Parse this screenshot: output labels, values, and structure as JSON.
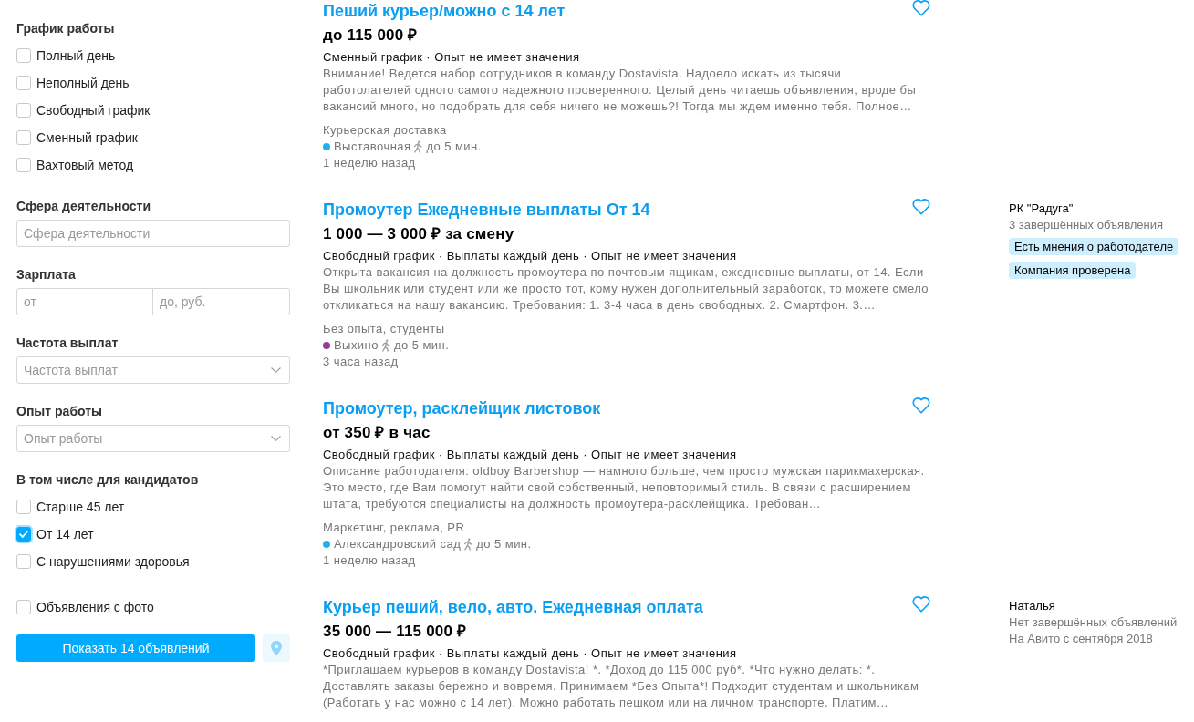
{
  "filters": {
    "sections": [
      {
        "kind": "checkboxes",
        "heading": "График работы",
        "options": [
          {
            "label": "Полный день",
            "checked": false
          },
          {
            "label": "Неполный день",
            "checked": false
          },
          {
            "label": "Свободный график",
            "checked": false
          },
          {
            "label": "Сменный график",
            "checked": false
          },
          {
            "label": "Вахтовый метод",
            "checked": false
          }
        ]
      },
      {
        "kind": "text",
        "heading": "Сфера деятельности",
        "placeholder": "Сфера деятельности"
      },
      {
        "kind": "range",
        "heading": "Зарплата",
        "fields": [
          {
            "placeholder": "от"
          },
          {
            "placeholder": "до, руб."
          }
        ]
      },
      {
        "kind": "select",
        "heading": "Частота выплат",
        "placeholder": "Частота выплат"
      },
      {
        "kind": "select",
        "heading": "Опыт работы",
        "placeholder": "Опыт работы"
      },
      {
        "kind": "checkboxes",
        "heading": "В том числе для кандидатов",
        "options": [
          {
            "label": "Старше 45 лет",
            "checked": false
          },
          {
            "label": "От 14 лет",
            "checked": true
          },
          {
            "label": "С нарушениями здоровья",
            "checked": false
          }
        ]
      },
      {
        "kind": "checkboxes",
        "options": [
          {
            "label": "Объявления с фото",
            "checked": false
          }
        ]
      }
    ],
    "show_button": "Показать 14 объявлений"
  },
  "listings": [
    {
      "title": "Пеший курьер/можно с 14 лет",
      "favorite": false,
      "price": "до 115 000 ₽",
      "tags": "Сменный график · Опыт не имеет значения",
      "description": "Внимание! Ведется набор сотрудников в команду Dostavista. Надоело искать из тысячи работолателей одного самого надежного проверенного. Целый день читаешь объявления, вроде бы вакансий много, но подобрать для себя ничего не можешь?! Тогда мы ждем именно тебя. Полное…",
      "category": "Курьерская доставка",
      "metro": {
        "station": "Выставочная",
        "color": "#1fb2e8",
        "walk": "до 5 мин."
      },
      "posted": "1 неделю назад"
    },
    {
      "title": "Промоутер Ежедневные выплаты От 14",
      "favorite": false,
      "price": "1 000 — 3 000 ₽ за смену",
      "tags": "Свободный график · Выплаты каждый день · Опыт не имеет значения",
      "description": "Открыта вакансия на должность промоутера по почтовым ящикам, ежедневные выплаты, от 14. Если Вы школьник или студент или же просто тот, кому нужен дополнительный заработок, то можете смело откликаться на нашу вакансию. Требования: 1. 3-4 часа в день свободных. 2. Смартфон. 3.…",
      "category": "Без опыта, студенты",
      "metro": {
        "station": "Выхино",
        "color": "#943e93",
        "walk": "до 5 мин."
      },
      "posted": "3 часа назад",
      "seller": {
        "name": "РК \"Радуга\"",
        "info": [
          "3 завершённых объявления"
        ],
        "badges": [
          "Есть мнения о работодателе",
          "Компания проверена"
        ]
      }
    },
    {
      "title": "Промоутер, расклейщик листовок",
      "favorite": false,
      "price": "от 350 ₽ в час",
      "tags": "Свободный график · Выплаты каждый день · Опыт не имеет значения",
      "description": "Описание работодателя: oldboy Barbershop — намного больше, чем просто мужская парикмахерская. Это место, где Вам помогут найти свой собственный, неповторимый стиль. В связи с расширением штата, требуются специалисты на должность промоутера-расклейщика. Требован…",
      "category": "Маркетинг, реклама, PR",
      "metro": {
        "station": "Александровский сад",
        "color": "#1fb2e8",
        "walk": "до 5 мин."
      },
      "posted": "1 неделю назад"
    },
    {
      "title": "Курьер пеший, вело, авто. Ежедневная оплата",
      "favorite": false,
      "price": "35 000 — 115 000 ₽",
      "tags": "Свободный график · Выплаты каждый день · Опыт не имеет значения",
      "description": "*Приглашаем курьеров в команду Dostavista! *. *Доход до 115 000 руб*. *Что нужно делать: *. Доставлять заказы бережно и вовремя. Принимаем *Без Опыта*! Подходит студентам и школьникам (Работать у нас можно с 14 лет). Можно работать пешком или на личном транспорте. Платим…",
      "seller": {
        "name": "Наталья",
        "info": [
          "Нет завершённых объявлений",
          "На Авито с сентября 2018"
        ]
      }
    }
  ]
}
